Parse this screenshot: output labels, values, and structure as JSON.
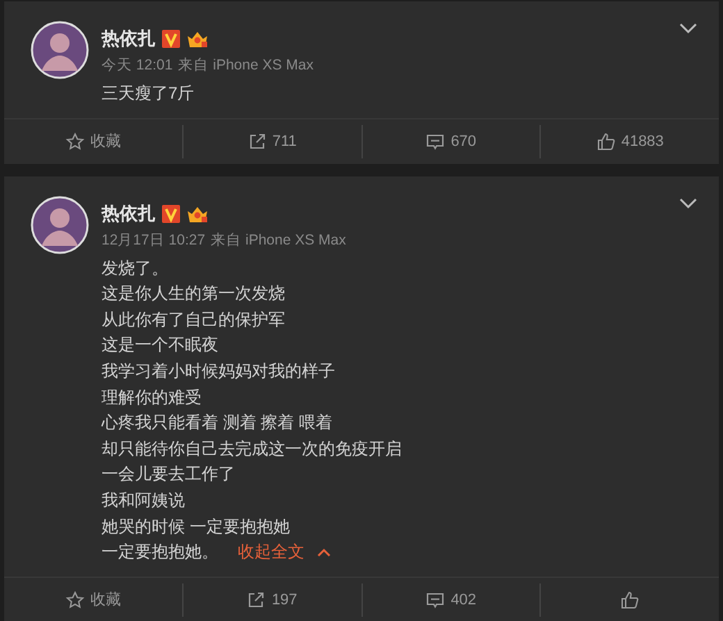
{
  "posts": [
    {
      "author": "热依扎",
      "time": "今天 12:01",
      "source": "来自 iPhone XS Max",
      "lines": [
        "三天瘦了7斤"
      ],
      "actions": [
        {
          "kind": "favorite",
          "label": "收藏"
        },
        {
          "kind": "repost",
          "label": "711"
        },
        {
          "kind": "comment",
          "label": "670"
        },
        {
          "kind": "like",
          "label": "41883"
        }
      ]
    },
    {
      "author": "热依扎",
      "time": "12月17日 10:27",
      "source": "来自 iPhone XS Max",
      "lines": [
        "发烧了。",
        "这是你人生的第一次发烧",
        "从此你有了自己的保护军",
        "这是一个不眠夜",
        "我学习着小时候妈妈对我的样子",
        "理解你的难受",
        "心疼我只能看着 测着 擦着 喂着",
        "却只能待你自己去完成这一次的免疫开启",
        "一会儿要去工作了",
        "我和阿姨说",
        "她哭的时候 一定要抱抱她",
        "一定要抱抱她。"
      ],
      "collapse_link": "收起全文",
      "actions": [
        {
          "kind": "favorite",
          "label": "收藏"
        },
        {
          "kind": "repost",
          "label": "197"
        },
        {
          "kind": "comment",
          "label": "402"
        },
        {
          "kind": "like"
        }
      ]
    }
  ]
}
